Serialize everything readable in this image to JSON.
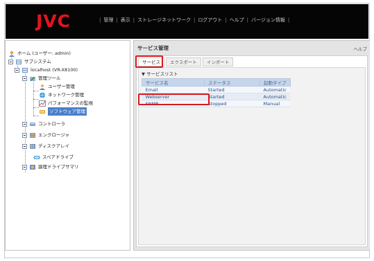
{
  "brand": {
    "logo": "JVC",
    "logo_color": "#e4141c"
  },
  "topmenu": [
    "管理",
    "表示",
    "ストレージネットワーク",
    "ログアウト",
    "ヘルプ",
    "バージョン情報"
  ],
  "tree": {
    "root": "ホーム (ユーザー: admin)",
    "subsystem": "サブシステム",
    "host": "localhost (VR-X8100)",
    "mgmt_tools": "管理ツール",
    "user_mgmt": "ユーザー管理",
    "network_mgmt": "ネットワーク管理",
    "perf_monitor": "パフォーマンスの監視",
    "software_mgmt": "ソフトウェア管理",
    "controller": "コントローラ",
    "enclosure": "エンクロージャ",
    "disk_array": "ディスクアレイ",
    "spare_drive": "スペアドライブ",
    "logical_drive_summary": "論理ドライブサマリ"
  },
  "right": {
    "title": "サービス管理",
    "help": "ヘルプ",
    "tabs": [
      "サービス",
      "エクスポート",
      "インポート"
    ],
    "section": "▼ サービスリスト",
    "columns": [
      "サービス名",
      "ステータス",
      "起動タイプ"
    ],
    "rows": [
      [
        "Email",
        "Started",
        "Automatic"
      ],
      [
        "Webserver",
        "Started",
        "Automatic"
      ],
      [
        "SNMP",
        "Stopped",
        "Manual"
      ]
    ]
  },
  "colors": {
    "highlight": "#d7191d",
    "header_bg": "#050505",
    "table_header": "#c5d6ec"
  }
}
